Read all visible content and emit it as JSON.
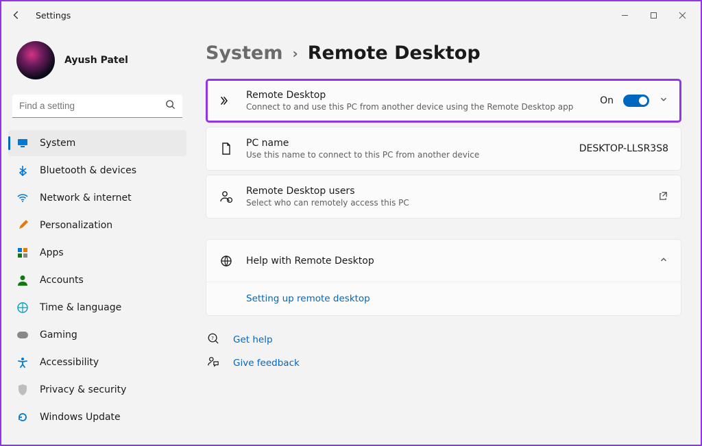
{
  "app_title": "Settings",
  "user": {
    "name": "Ayush Patel"
  },
  "search": {
    "placeholder": "Find a setting"
  },
  "sidebar": {
    "items": [
      {
        "label": "System",
        "icon": "monitor",
        "color": "c-blue",
        "selected": true
      },
      {
        "label": "Bluetooth & devices",
        "icon": "bluetooth",
        "color": "c-blue"
      },
      {
        "label": "Network & internet",
        "icon": "wifi",
        "color": "c-blue"
      },
      {
        "label": "Personalization",
        "icon": "brush",
        "color": "c-orange"
      },
      {
        "label": "Apps",
        "icon": "apps",
        "color": "c-blue"
      },
      {
        "label": "Accounts",
        "icon": "person",
        "color": "c-green"
      },
      {
        "label": "Time & language",
        "icon": "globe-clock",
        "color": "c-cyan"
      },
      {
        "label": "Gaming",
        "icon": "gamepad",
        "color": "c-gray"
      },
      {
        "label": "Accessibility",
        "icon": "accessibility",
        "color": "c-blue"
      },
      {
        "label": "Privacy & security",
        "icon": "shield",
        "color": "c-gray"
      },
      {
        "label": "Windows Update",
        "icon": "update",
        "color": "c-blue"
      }
    ]
  },
  "breadcrumb": {
    "parent": "System",
    "current": "Remote Desktop"
  },
  "remote_desktop": {
    "title": "Remote Desktop",
    "subtitle": "Connect to and use this PC from another device using the Remote Desktop app",
    "state_label": "On"
  },
  "pc_name": {
    "title": "PC name",
    "subtitle": "Use this name to connect to this PC from another device",
    "value": "DESKTOP-LLSR3S8"
  },
  "users": {
    "title": "Remote Desktop users",
    "subtitle": "Select who can remotely access this PC"
  },
  "help": {
    "title": "Help with Remote Desktop",
    "link": "Setting up remote desktop"
  },
  "footer": {
    "get_help": "Get help",
    "feedback": "Give feedback"
  }
}
